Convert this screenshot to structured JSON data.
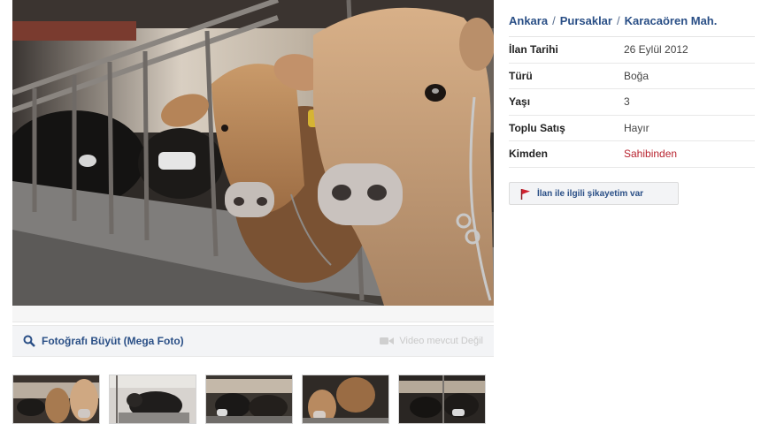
{
  "breadcrumb": {
    "city": "Ankara",
    "district": "Pursaklar",
    "neighborhood": "Karacaören Mah.",
    "separator": "/"
  },
  "details": [
    {
      "label": "İlan Tarihi",
      "value": "26 Eylül 2012"
    },
    {
      "label": "Türü",
      "value": "Boğa"
    },
    {
      "label": "Yaşı",
      "value": "3"
    },
    {
      "label": "Toplu Satış",
      "value": "Hayır"
    },
    {
      "label": "Kimden",
      "value": "Sahibinden"
    }
  ],
  "report_button": {
    "label": "İlan ile ilgili şikayetim var",
    "icon": "flag-icon"
  },
  "gallery": {
    "enlarge_label": "Fotoğrafı Büyüt (Mega Foto)",
    "enlarge_icon": "magnifier-icon",
    "video_label": "Video mevcut Değil",
    "video_icon": "video-camera-icon"
  },
  "colors": {
    "link": "#2a4f86",
    "highlight": "#b8232f",
    "flag": "#d0222f"
  }
}
